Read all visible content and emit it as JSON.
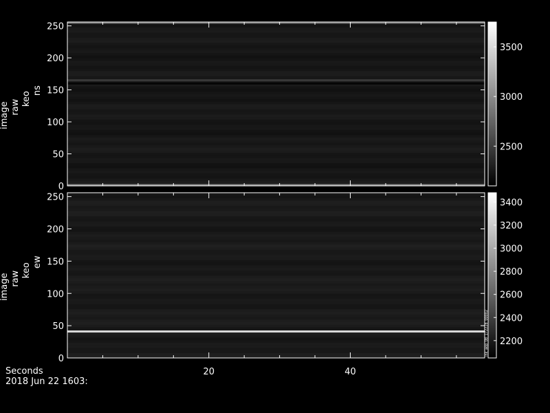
{
  "chart_data": [
    {
      "type": "heatmap",
      "ylabel": [
        "image",
        "raw",
        "keo",
        "ns"
      ],
      "ylim": [
        0,
        256
      ],
      "yticks": [
        0,
        50,
        100,
        150,
        200,
        250
      ],
      "xlim": [
        0,
        59
      ],
      "colorbar": {
        "ticks": [
          2500,
          3000,
          3500
        ],
        "range": [
          2100,
          3750
        ]
      },
      "features": [
        {
          "row": 165,
          "intensity": 0.22
        },
        {
          "row": 160,
          "intensity": 0.02
        },
        {
          "row": 255,
          "intensity": 0.45
        },
        {
          "row": 1,
          "intensity": 0.55
        }
      ],
      "background_intensity": 0.09
    },
    {
      "type": "heatmap",
      "ylabel": [
        "image",
        "raw",
        "keo",
        "ew"
      ],
      "ylim": [
        0,
        256
      ],
      "yticks": [
        0,
        50,
        100,
        150,
        200,
        250
      ],
      "xlim": [
        0,
        59
      ],
      "colorbar": {
        "ticks": [
          2200,
          2400,
          2600,
          2800,
          3000,
          3200,
          3400
        ],
        "range": [
          2050,
          3480
        ]
      },
      "colorbar_note": "ink_aop_08_172228_00002",
      "features": [
        {
          "row": 41,
          "intensity": 0.85
        }
      ],
      "background_intensity": 0.1
    }
  ],
  "xaxis": {
    "label": "Seconds",
    "ticks": [
      20,
      40
    ],
    "date_label": "2018 Jun 22 1603:"
  }
}
